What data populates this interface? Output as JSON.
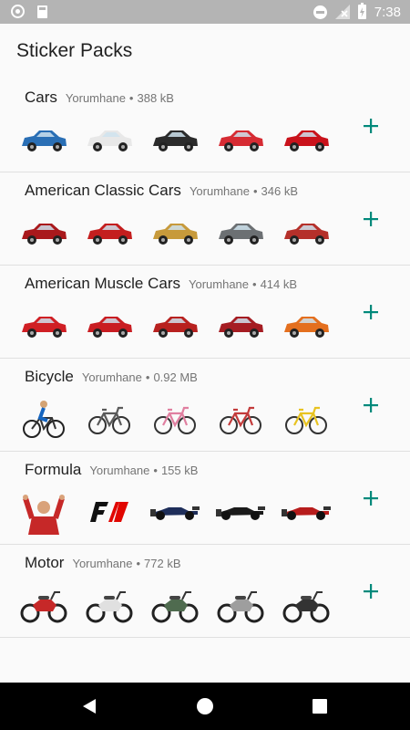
{
  "status_bar": {
    "time": "7:38",
    "icons": [
      "notification-circle-icon",
      "sd-card-icon",
      "dnd-icon",
      "no-signal-icon",
      "battery-charging-icon"
    ]
  },
  "page": {
    "title": "Sticker Packs"
  },
  "packs": [
    {
      "name": "Cars",
      "publisher": "Yorumhane",
      "separator": "•",
      "size": "388 kB",
      "stickers": [
        "blue-race-car-icon",
        "white-sports-car-icon",
        "black-green-car-icon",
        "red-white-car-icon",
        "red-sports-car-icon"
      ],
      "colors": [
        "#2a6fb5",
        "#e8e8e8",
        "#2b2b2b",
        "#d62b33",
        "#c9121b"
      ]
    },
    {
      "name": "American Classic Cars",
      "publisher": "Yorumhane",
      "separator": "•",
      "size": "346 kB",
      "stickers": [
        "red-classic-car-icon",
        "red-convertible-icon",
        "gold-muscle-car-icon",
        "gray-vintage-car-icon",
        "red-mustang-icon"
      ],
      "colors": [
        "#a9191c",
        "#c41e1e",
        "#c79a3b",
        "#6c7073",
        "#b5302a"
      ]
    },
    {
      "name": "American Muscle Cars",
      "publisher": "Yorumhane",
      "separator": "•",
      "size": "414 kB",
      "stickers": [
        "red-muscle-car-icon",
        "red-coupe-icon",
        "red-camaro-icon",
        "red-mustang-icon",
        "orange-challenger-icon"
      ],
      "colors": [
        "#d01f24",
        "#c91d22",
        "#b8211f",
        "#a51c22",
        "#e46f1e"
      ]
    },
    {
      "name": "Bicycle",
      "publisher": "Yorumhane",
      "separator": "•",
      "size": "0.92 MB",
      "stickers": [
        "cyclist-icon",
        "cruiser-bike-icon",
        "pink-bike-icon",
        "red-bike-icon",
        "yellow-bike-icon"
      ],
      "colors": [
        "#333333",
        "#5a5a5a",
        "#e07fa0",
        "#c33b3b",
        "#e8c321"
      ]
    },
    {
      "name": "Formula",
      "publisher": "Yorumhane",
      "separator": "•",
      "size": "155 kB",
      "stickers": [
        "driver-celebrating-icon",
        "f1-logo-icon",
        "f1-car-icon",
        "black-f1-car-icon",
        "red-f1-car-icon"
      ],
      "colors": [
        "#c62828",
        "#222222",
        "#1e2e5a",
        "#1a1a1a",
        "#b71c1c"
      ]
    },
    {
      "name": "Motor",
      "publisher": "Yorumhane",
      "separator": "•",
      "size": "772 kB",
      "stickers": [
        "red-scooter-icon",
        "white-vespa-icon",
        "green-scooter-icon",
        "silver-motorcycle-icon",
        "black-motorcycle-icon"
      ],
      "colors": [
        "#c62828",
        "#e0e0e0",
        "#4f6b4f",
        "#9e9e9e",
        "#333333"
      ]
    }
  ],
  "add_label": "+",
  "accent": "#00897b",
  "nav_bar": {
    "buttons": [
      "back-icon",
      "home-icon",
      "recents-icon"
    ]
  }
}
